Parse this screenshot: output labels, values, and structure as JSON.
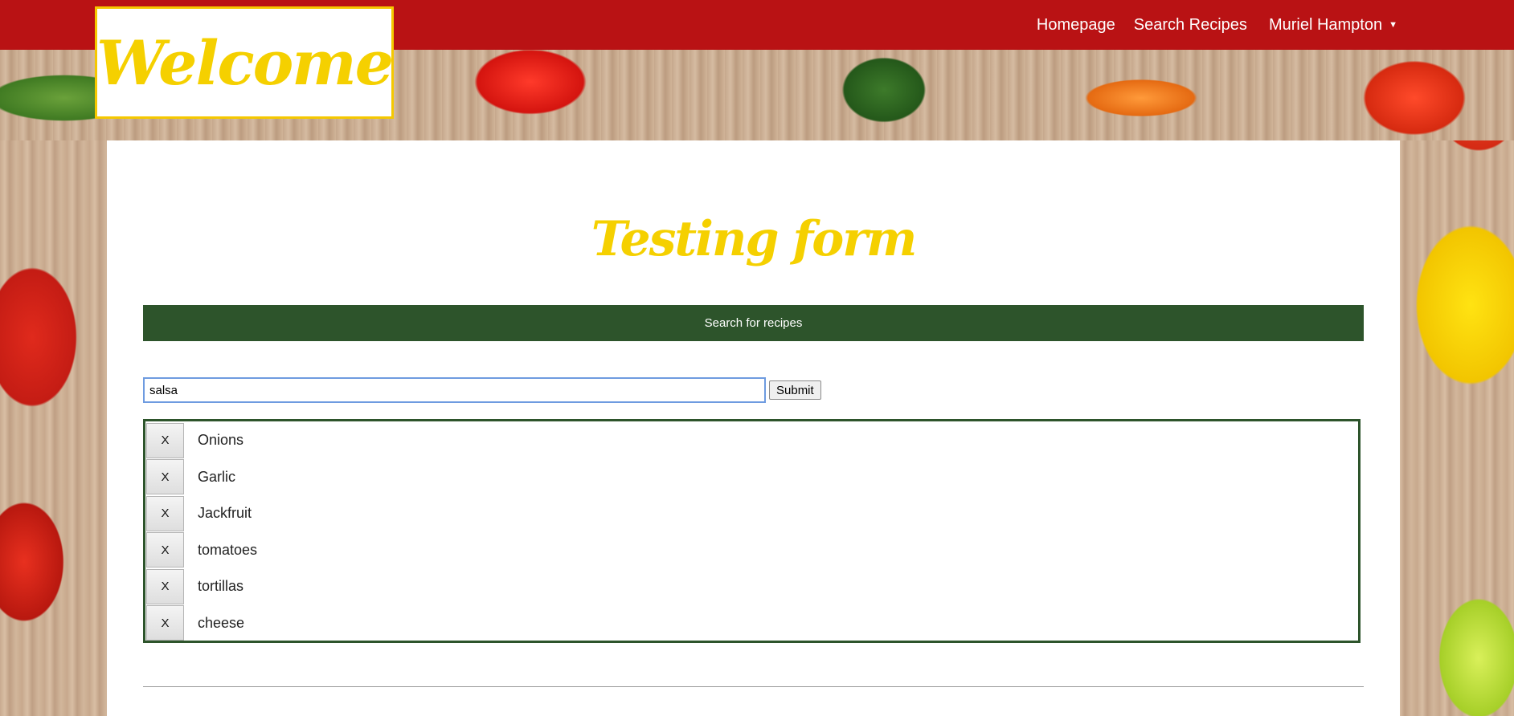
{
  "header": {
    "logo_text": "Welcome",
    "nav": {
      "homepage": "Homepage",
      "search_recipes": "Search Recipes",
      "user_name": "Muriel Hampton",
      "user_caret": "▼"
    }
  },
  "main": {
    "title": "Testing form",
    "banner": "Search for recipes",
    "search": {
      "value": "salsa",
      "submit_label": "Submit"
    },
    "ingredients": [
      {
        "remove_label": "X",
        "name": "Onions"
      },
      {
        "remove_label": "X",
        "name": "Garlic"
      },
      {
        "remove_label": "X",
        "name": "Jackfruit"
      },
      {
        "remove_label": "X",
        "name": "tomatoes"
      },
      {
        "remove_label": "X",
        "name": "tortillas"
      },
      {
        "remove_label": "X",
        "name": "cheese"
      }
    ]
  },
  "colors": {
    "nav_bg": "#b91214",
    "accent_yellow": "#f5d000",
    "banner_green": "#2d542b"
  }
}
